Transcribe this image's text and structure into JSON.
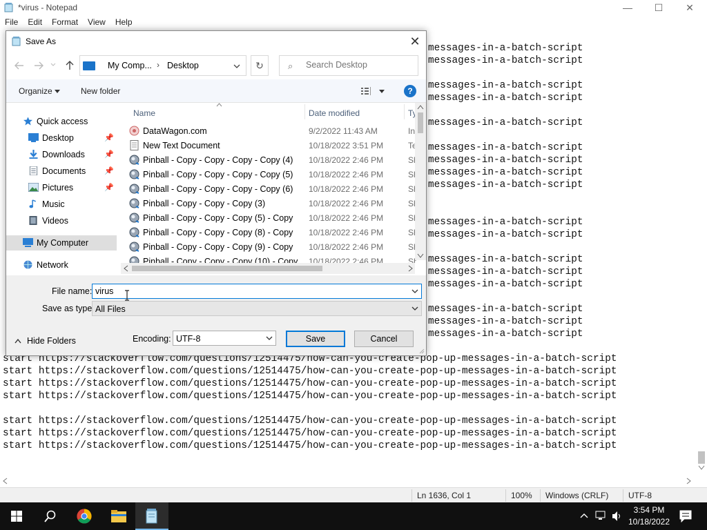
{
  "notepad": {
    "title": "*virus - Notepad",
    "menu": [
      "File",
      "Edit",
      "Format",
      "View",
      "Help"
    ],
    "window_controls": {
      "minimize": "—",
      "maximize": "☐",
      "close": "✕"
    },
    "line_tail": "messages-in-a-batch-script",
    "full_line": "start https://stackoverflow.com/questions/12514475/how-can-you-create-pop-up-messages-in-a-batch-script",
    "status": {
      "position": "Ln 1636, Col 1",
      "zoom": "100%",
      "line_ending": "Windows (CRLF)",
      "encoding": "UTF-8"
    }
  },
  "save_dialog": {
    "title": "Save As",
    "close": "✕",
    "breadcrumb": [
      "My Comp...",
      "Desktop"
    ],
    "search_placeholder": "Search Desktop",
    "toolbar": {
      "organize": "Organize",
      "new_folder": "New folder",
      "help": "?"
    },
    "nav": [
      {
        "label": "Quick access",
        "icon": "star-icon"
      },
      {
        "label": "Desktop",
        "icon": "desktop-icon",
        "pinned": true
      },
      {
        "label": "Downloads",
        "icon": "download-icon",
        "pinned": true
      },
      {
        "label": "Documents",
        "icon": "documents-icon",
        "pinned": true
      },
      {
        "label": "Pictures",
        "icon": "pictures-icon",
        "pinned": true
      },
      {
        "label": "Music",
        "icon": "music-icon"
      },
      {
        "label": "Videos",
        "icon": "videos-icon"
      },
      {
        "label": "My Computer",
        "icon": "computer-icon",
        "selected": true
      },
      {
        "label": "Network",
        "icon": "network-icon"
      }
    ],
    "columns": {
      "name": "Name",
      "date": "Date modified",
      "type": "Ty"
    },
    "files": [
      {
        "name": "DataWagon.com",
        "date": "9/2/2022 11:43 AM",
        "type": "In",
        "icon": "web-shortcut-icon"
      },
      {
        "name": "New Text Document",
        "date": "10/18/2022 3:51 PM",
        "type": "Te",
        "icon": "text-file-icon"
      },
      {
        "name": "Pinball - Copy - Copy - Copy - Copy (4)",
        "date": "10/18/2022 2:46 PM",
        "type": "Sh",
        "icon": "pinball-icon"
      },
      {
        "name": "Pinball - Copy - Copy - Copy - Copy (5)",
        "date": "10/18/2022 2:46 PM",
        "type": "Sh",
        "icon": "pinball-icon"
      },
      {
        "name": "Pinball - Copy - Copy - Copy - Copy (6)",
        "date": "10/18/2022 2:46 PM",
        "type": "Sh",
        "icon": "pinball-icon"
      },
      {
        "name": "Pinball - Copy - Copy - Copy (3)",
        "date": "10/18/2022 2:46 PM",
        "type": "Sh",
        "icon": "pinball-icon"
      },
      {
        "name": "Pinball - Copy - Copy - Copy (5) - Copy",
        "date": "10/18/2022 2:46 PM",
        "type": "Sh",
        "icon": "pinball-icon"
      },
      {
        "name": "Pinball - Copy - Copy - Copy (8) - Copy",
        "date": "10/18/2022 2:46 PM",
        "type": "Sh",
        "icon": "pinball-icon"
      },
      {
        "name": "Pinball - Copy - Copy - Copy (9) - Copy",
        "date": "10/18/2022 2:46 PM",
        "type": "Sh",
        "icon": "pinball-icon"
      },
      {
        "name": "Pinball - Copy - Copy - Copy (10) - Copy",
        "date": "10/18/2022 2:46 PM",
        "type": "Sh",
        "icon": "pinball-icon"
      }
    ],
    "file_name_label": "File name:",
    "file_name_value": "virus",
    "save_type_label": "Save as type:",
    "save_type_value": "All Files",
    "hide_folders": "Hide Folders",
    "encoding_label": "Encoding:",
    "encoding_value": "UTF-8",
    "save": "Save",
    "cancel": "Cancel"
  },
  "taskbar": {
    "time": "3:54 PM",
    "date": "10/18/2022",
    "apps": [
      "start-icon",
      "search-icon",
      "chrome-icon",
      "file-explorer-icon",
      "notepad-icon"
    ]
  },
  "colors": {
    "accent": "#0078d7",
    "taskbar": "#101010",
    "selected_nav": "#dedede"
  }
}
